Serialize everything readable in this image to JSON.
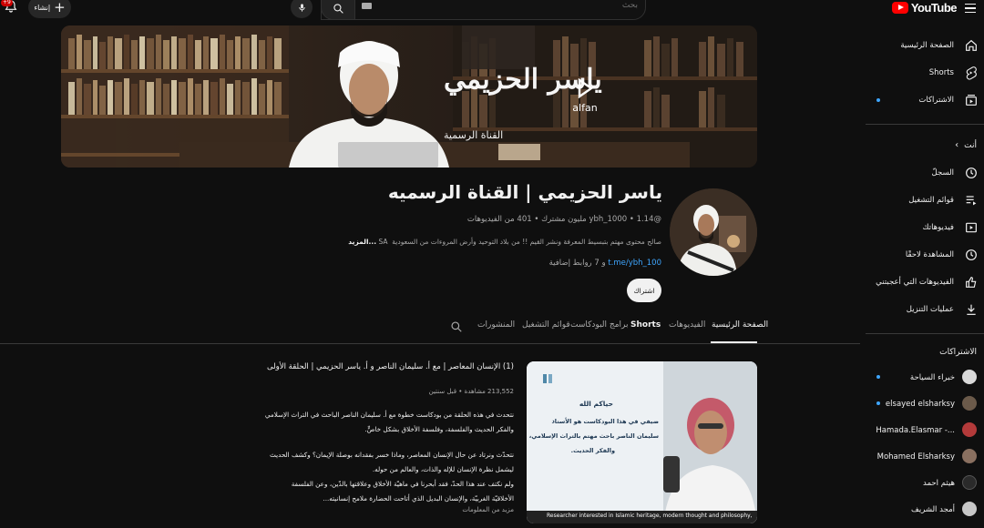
{
  "topbar": {
    "logo_text": "YouTube",
    "search_placeholder": "بحث",
    "create_label": "إنشاء",
    "notification_count": "+9"
  },
  "sidebar": {
    "main": [
      {
        "label": "الصفحة الرئيسية",
        "icon": "home-icon"
      },
      {
        "label": "Shorts",
        "icon": "shorts-icon"
      },
      {
        "label": "الاشتراكات",
        "icon": "subscriptions-icon"
      }
    ],
    "you_heading": "أنت",
    "you": [
      {
        "label": "السجلّ",
        "icon": "history-icon"
      },
      {
        "label": "قوائم التشغيل",
        "icon": "playlists-icon"
      },
      {
        "label": "فيديوهاتك",
        "icon": "your-videos-icon"
      },
      {
        "label": "المشاهدة لاحقًا",
        "icon": "watch-later-icon"
      },
      {
        "label": "الفيديوهات التي أعجبتني",
        "icon": "liked-icon"
      },
      {
        "label": "عمليات التنزيل",
        "icon": "download-icon"
      }
    ],
    "subs_heading": "الاشتراكات",
    "subscriptions": [
      {
        "label": "خبراء السياحة",
        "color": "#d9d9d9"
      },
      {
        "label": "elsayed elsharksy",
        "color": "#6b5a4a"
      },
      {
        "label": "Hamada.Elasmar -...",
        "color": "#b33a3a"
      },
      {
        "label": "Mohamed Elsharksy",
        "color": "#8a7060"
      },
      {
        "label": "هيثم احمد",
        "color": "#2a2a2a"
      },
      {
        "label": "أمجد الشريف",
        "color": "#c7c7c7"
      }
    ]
  },
  "channel": {
    "name": "ياسر الحزيمي | القناة الرسميه",
    "handle_stats": "@ybh_1000 • 1.14 مليون مشترك • 401 من الفيديوهات",
    "description": "صالح محتوى مهتم بتبسيط المعرفة ونشر القيم !! من بلاد التوحيد وأرض المروءات من السعودية",
    "desc_flag": "SA",
    "desc_more": "...المزيد",
    "link_text": "t.me/ybh_100",
    "links_suffix": "و 7 روابط إضافية",
    "subscribe_label": "اشتراك",
    "banner_title": "ياسر الحزيمي",
    "banner_subtitle": "القناة الرسمية",
    "banner_brand": "alfan"
  },
  "tabs": [
    "الصفحة الرئيسية",
    "الفيديوهات",
    "Shorts",
    "برامج البودكاست",
    "قوائم التشغيل",
    "المنشورات"
  ],
  "video": {
    "title": "(1) الإنسان المعاصر | مع أ. سليمان الناصر و أ. ياسر الحزيمي | الحلقة الأولى",
    "meta": "213,552 مشاهدة • قبل سنتين",
    "p1": "نتحدث في هذه الحلقة من بودكاست خطوة مع أ. سليمان الناصر الباحث في التراث الإسلامي",
    "p2": "والفكر الحديث والفلسفة، وفلسفة الأخلاق بشكل خاصٍّ.",
    "p3": "نتحدّث ونرتاد عن حال الإنسان المعاصر، وماذا خسر بفقدانه بوصلة الإيمان؟ وكشف الحديث",
    "p4": "ليشمل نظرة الإنسان للإله والذات، والعالم من حوله.",
    "p5": "ولم نكتف عند هذا الحدّ، فقد أبحرنا في ماهيّة الأخلاق وعلاقتها بالدّين، وعن الفلسفة",
    "p6": "الأخلاقيّة الغربيّة، والإنسان البديل الذي أتاحت الحضارة ملامح إنسانيته...",
    "more": "مزيد من المعلومات",
    "thumb_greeting": "حياكم الله",
    "thumb_line1": "ضيفي في هذا البودكاست هو الأستاذ",
    "thumb_line2": "سليمان الناصر باحث مهتم بالتراث الإسلامي،",
    "thumb_line3": "والفكر الحديث.",
    "thumb_caption": "Researcher interested in Islamic heritage, modern thought and philosophy,"
  }
}
